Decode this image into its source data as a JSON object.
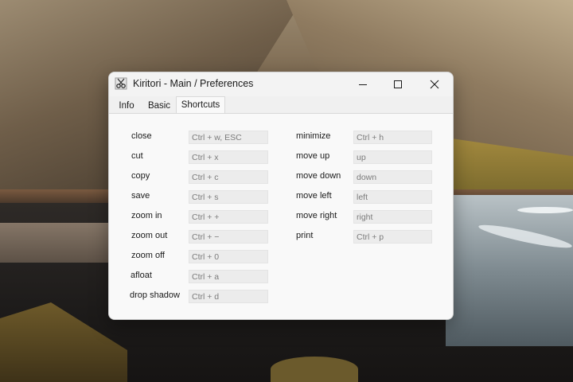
{
  "window": {
    "title": "Kiritori - Main / Preferences",
    "tabs": [
      "Info",
      "Basic",
      "Shortcuts"
    ],
    "active_tab": "Shortcuts"
  },
  "shortcuts": {
    "left": [
      {
        "label": "close",
        "value": "Ctrl + w, ESC"
      },
      {
        "label": "cut",
        "value": "Ctrl + x"
      },
      {
        "label": "copy",
        "value": "Ctrl + c"
      },
      {
        "label": "save",
        "value": "Ctrl + s"
      },
      {
        "label": "zoom in",
        "value": "Ctrl + +"
      },
      {
        "label": "zoom out",
        "value": "Ctrl + −"
      },
      {
        "label": "zoom off",
        "value": "Ctrl + 0"
      },
      {
        "label": "afloat",
        "value": "Ctrl + a"
      },
      {
        "label": "drop shadow",
        "value": "Ctrl + d"
      }
    ],
    "right": [
      {
        "label": "minimize",
        "value": "Ctrl + h"
      },
      {
        "label": "move up",
        "value": "up"
      },
      {
        "label": "move down",
        "value": "down"
      },
      {
        "label": "move left",
        "value": "left"
      },
      {
        "label": "move right",
        "value": "right"
      },
      {
        "label": "print",
        "value": "Ctrl + p"
      }
    ]
  },
  "icons": {
    "app": "scissors-icon",
    "minimize": "minimize-icon",
    "maximize": "maximize-icon",
    "close": "close-icon"
  }
}
